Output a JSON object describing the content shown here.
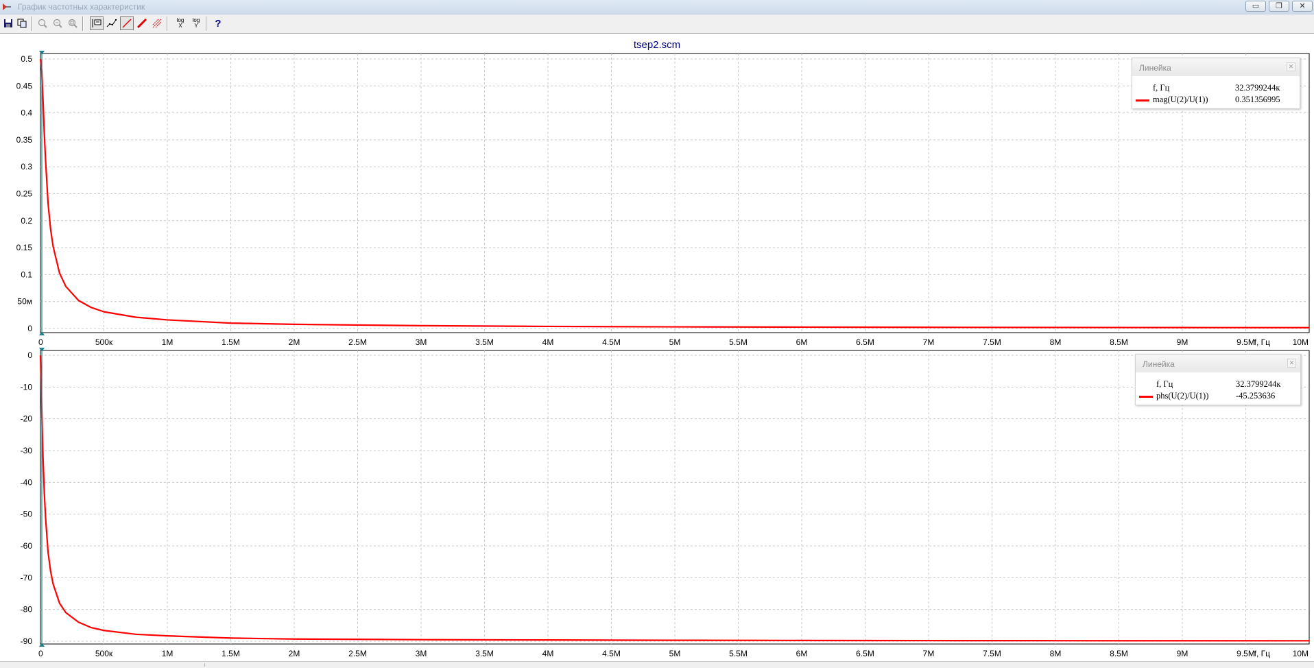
{
  "window": {
    "title": "График частотных характеристик",
    "buttons": [
      "minimize",
      "restore",
      "close"
    ]
  },
  "toolbar": {
    "buttons": [
      {
        "icon": "save-icon",
        "pressed": false
      },
      {
        "icon": "copy-icon",
        "pressed": false
      },
      {
        "icon": "zoom-in-icon",
        "pressed": false,
        "disabled": true
      },
      {
        "icon": "zoom-out-icon",
        "pressed": false,
        "disabled": true
      },
      {
        "icon": "zoom-fit-icon",
        "pressed": false,
        "disabled": true
      },
      {
        "icon": "legend-icon",
        "pressed": true
      },
      {
        "icon": "markers-icon",
        "pressed": false
      },
      {
        "icon": "line-icon",
        "pressed": true
      },
      {
        "icon": "thick-line-icon",
        "pressed": false
      },
      {
        "icon": "grid-icon",
        "pressed": false
      },
      {
        "icon": "log-x-icon",
        "pressed": false
      },
      {
        "icon": "log-y-icon",
        "pressed": false
      },
      {
        "icon": "help-icon",
        "pressed": false
      }
    ],
    "log_label": "log",
    "log_x_label": "X",
    "log_y_label": "Y",
    "help_label": "?"
  },
  "plot_title": "tsep2.scm",
  "legend_header": "Линейка",
  "colors": {
    "trace": "#ff0000",
    "cursor": "#1f7f8c",
    "grid": "#c8c8c8",
    "frame": "#000000"
  },
  "chart_data": [
    {
      "type": "line",
      "title": "tsep2.scm",
      "xlabel": "f, Гц",
      "ylabel": "",
      "xlim": [
        0,
        10000000
      ],
      "ylim": [
        0,
        0.5
      ],
      "grid": true,
      "x_ticks": [
        "0",
        "500к",
        "1M",
        "1.5M",
        "2M",
        "2.5M",
        "3M",
        "3.5M",
        "4M",
        "4.5M",
        "5M",
        "5.5M",
        "6M",
        "6.5M",
        "7M",
        "7.5M",
        "8M",
        "8.5M",
        "9M",
        "9.5M",
        "10M"
      ],
      "y_ticks": [
        "0",
        "50м",
        "0.1",
        "0.15",
        "0.2",
        "0.25",
        "0.3",
        "0.35",
        "0.4",
        "0.45",
        "0.5"
      ],
      "series": [
        {
          "name": "mag(U(2)/U(1))",
          "x": [
            0,
            10000,
            20000,
            30000,
            40000,
            60000,
            80000,
            100000,
            150000,
            200000,
            300000,
            400000,
            500000,
            750000,
            1000000,
            1500000,
            2000000,
            3000000,
            4000000,
            5000000,
            6000000,
            7000000,
            8000000,
            9000000,
            10000000
          ],
          "y": [
            0.5,
            0.478,
            0.425,
            0.363,
            0.313,
            0.232,
            0.184,
            0.152,
            0.103,
            0.078,
            0.052,
            0.039,
            0.031,
            0.021,
            0.016,
            0.01,
            0.0078,
            0.0052,
            0.0039,
            0.0031,
            0.0026,
            0.0022,
            0.002,
            0.0017,
            0.0016
          ]
        }
      ],
      "cursor": {
        "x_label": "f, Гц",
        "x_value": "32.3799244к",
        "series_label": "mag(U(2)/U(1))",
        "series_value": "0.351356995"
      }
    },
    {
      "type": "line",
      "title": "",
      "xlabel": "f, Гц",
      "ylabel": "",
      "xlim": [
        0,
        10000000
      ],
      "ylim": [
        -90,
        0
      ],
      "grid": true,
      "x_ticks": [
        "0",
        "500к",
        "1M",
        "1.5M",
        "2M",
        "2.5M",
        "3M",
        "3.5M",
        "4M",
        "4.5M",
        "5M",
        "5.5M",
        "6M",
        "6.5M",
        "7M",
        "7.5M",
        "8M",
        "8.5M",
        "9M",
        "9.5M",
        "10M"
      ],
      "y_ticks": [
        "0",
        "-10",
        "-20",
        "-30",
        "-40",
        "-50",
        "-60",
        "-70",
        "-80",
        "-90"
      ],
      "series": [
        {
          "name": "phs(U(2)/U(1))",
          "x": [
            0,
            10000,
            20000,
            30000,
            40000,
            60000,
            80000,
            100000,
            150000,
            200000,
            300000,
            400000,
            500000,
            750000,
            1000000,
            1500000,
            2000000,
            3000000,
            4000000,
            5000000,
            6000000,
            7000000,
            8000000,
            9000000,
            10000000
          ],
          "y": [
            0,
            -17,
            -32,
            -43,
            -51,
            -62,
            -68,
            -72,
            -78,
            -81,
            -84,
            -85.7,
            -86.6,
            -87.8,
            -88.3,
            -89.0,
            -89.3,
            -89.5,
            -89.6,
            -89.7,
            -89.75,
            -89.8,
            -89.82,
            -89.84,
            -89.85
          ]
        }
      ],
      "cursor": {
        "x_label": "f, Гц",
        "x_value": "32.3799244к",
        "series_label": "phs(U(2)/U(1))",
        "series_value": "-45.253636"
      }
    }
  ]
}
